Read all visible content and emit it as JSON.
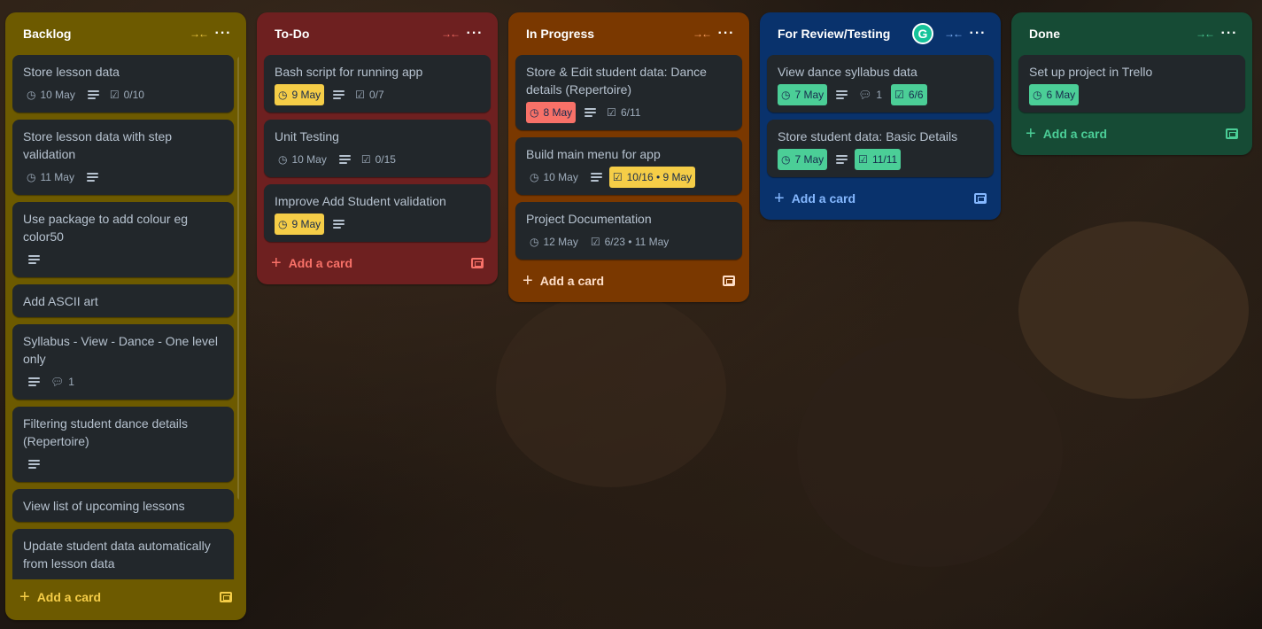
{
  "colors": {
    "backlog": "#6d5a00",
    "todo": "#6e2020",
    "in_progress": "#7a3800",
    "review": "#09326c",
    "done": "#164b35"
  },
  "lists": {
    "backlog": {
      "title": "Backlog",
      "add_label": "Add a card",
      "cards": [
        {
          "title": "Store lesson data",
          "date": "10 May",
          "check": "0/10"
        },
        {
          "title": "Store lesson data with step validation",
          "date": "11 May"
        },
        {
          "title": "Use package to add colour eg color50"
        },
        {
          "title": "Add ASCII art"
        },
        {
          "title": "Syllabus - View - Dance - One level only",
          "comments": "1"
        },
        {
          "title": "Filtering student dance details (Repertoire)"
        },
        {
          "title": "View list of upcoming lessons"
        },
        {
          "title": "Update student data automatically from lesson data"
        }
      ]
    },
    "todo": {
      "title": "To-Do",
      "add_label": "Add a card",
      "cards": [
        {
          "title": "Bash script for running app",
          "date": "9 May",
          "check": "0/7"
        },
        {
          "title": "Unit Testing",
          "date": "10 May",
          "check": "0/15"
        },
        {
          "title": "Improve Add Student validation",
          "date": "9 May"
        }
      ]
    },
    "in_progress": {
      "title": "In Progress",
      "add_label": "Add a card",
      "cards": [
        {
          "title": "Store & Edit student data: Dance details (Repertoire)",
          "date": "8 May",
          "check": "6/11"
        },
        {
          "title": "Build main menu for app",
          "date": "10 May",
          "check": "10/16 • 9 May"
        },
        {
          "title": "Project Documentation",
          "date": "12 May",
          "check": "6/23 • 11 May"
        }
      ]
    },
    "review": {
      "title": "For Review/Testing",
      "add_label": "Add a card",
      "grammarly": "G",
      "cards": [
        {
          "title": "View dance syllabus data",
          "date": "7 May",
          "comments": "1",
          "check": "6/6"
        },
        {
          "title": "Store student data: Basic Details",
          "date": "7 May",
          "check": "11/11"
        }
      ]
    },
    "done": {
      "title": "Done",
      "add_label": "Add a card",
      "cards": [
        {
          "title": "Set up project in Trello",
          "date": "6 May"
        }
      ]
    }
  }
}
